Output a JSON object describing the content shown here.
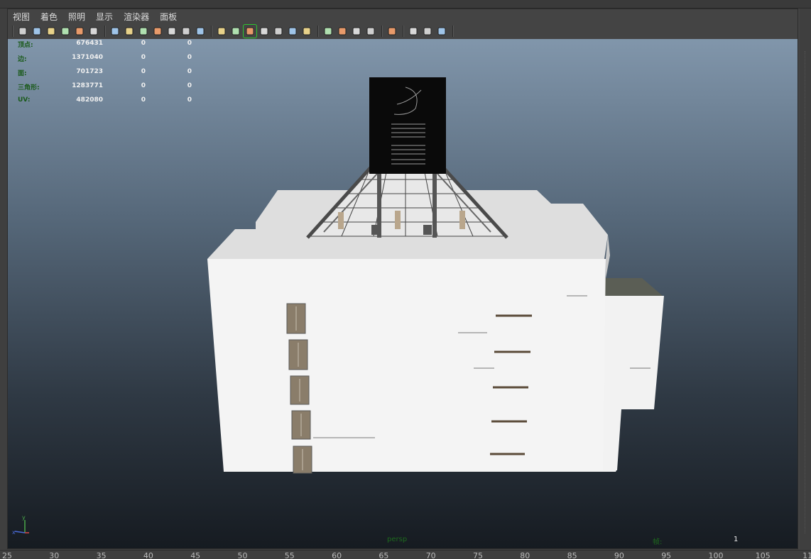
{
  "menu": {
    "items": [
      "视图",
      "着色",
      "照明",
      "显示",
      "渲染器",
      "面板"
    ]
  },
  "toolbar": {
    "groups": [
      [
        "camera-select-icon",
        "camera-attributes-icon",
        "bookmark-icon",
        "image-plane-icon",
        "2d-pan-zoom-icon",
        "grease-pencil-icon"
      ],
      [
        "grid-icon",
        "film-gate-icon",
        "resolution-gate-icon",
        "gate-mask-icon",
        "field-chart-icon",
        "safe-action-icon",
        "safe-title-icon"
      ],
      [
        "wireframe-icon",
        "smooth-shade-icon",
        "wireframe-on-shaded-icon",
        "default-material-icon",
        "textured-icon",
        "use-lights-icon",
        "all-lights-icon"
      ],
      [
        "shadows-icon",
        "screen-space-ao-icon",
        "motion-blur-icon",
        "multisample-aa-icon"
      ],
      [
        "isolate-select-icon"
      ],
      [
        "xray-icon",
        "xray-joints-icon",
        "xray-components-icon"
      ]
    ],
    "active": "wireframe-on-shaded-icon"
  },
  "hud": {
    "rows": [
      {
        "label": "顶点:",
        "v1": "676431",
        "v2": "0",
        "v3": "0"
      },
      {
        "label": "边:",
        "v1": "1371040",
        "v2": "0",
        "v3": "0"
      },
      {
        "label": "面:",
        "v1": "701723",
        "v2": "0",
        "v3": "0"
      },
      {
        "label": "三角形:",
        "v1": "1283771",
        "v2": "0",
        "v3": "0"
      },
      {
        "label": "UV:",
        "v1": "482080",
        "v2": "0",
        "v3": "0"
      }
    ]
  },
  "viewport": {
    "camera": "persp",
    "frame_label": "帧:",
    "frame_value": "1"
  },
  "axis": {
    "y": "y",
    "x": "x"
  },
  "ruler": {
    "ticks": [
      "25",
      "30",
      "35",
      "40",
      "45",
      "50",
      "55",
      "60",
      "65",
      "70",
      "75",
      "80",
      "85",
      "90",
      "95",
      "100",
      "105",
      "11"
    ]
  },
  "colors": {
    "hud_label": "#1a5a1a",
    "hud_value": "#f0f0f0",
    "active_outline": "#2ec62e"
  }
}
